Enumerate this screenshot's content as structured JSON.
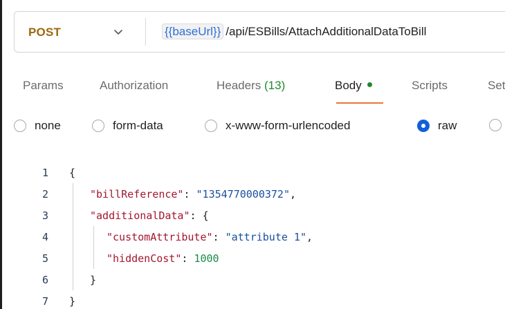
{
  "request": {
    "method": "POST",
    "url_variable": "{{baseUrl}}",
    "url_path": "/api/ESBills/AttachAdditionalDataToBill"
  },
  "tabs": [
    {
      "label": "Params"
    },
    {
      "label": "Authorization"
    },
    {
      "label": "Headers",
      "count": "(13)"
    },
    {
      "label": "Body"
    },
    {
      "label": "Scripts"
    },
    {
      "label": "Set"
    }
  ],
  "body_types": {
    "none": "none",
    "form_data": "form-data",
    "urlencoded": "x-www-form-urlencoded",
    "raw": "raw",
    "selected": "raw"
  },
  "editor": {
    "line_numbers": [
      "1",
      "2",
      "3",
      "4",
      "5",
      "6",
      "7"
    ],
    "open_brace": "{",
    "close_brace": "}",
    "key_billReference": "\"billReference\"",
    "val_billReference": "\"1354770000372\"",
    "key_additionalData": "\"additionalData\"",
    "key_customAttribute": "\"customAttribute\"",
    "val_customAttribute": "\"attribute 1\"",
    "key_hiddenCost": "\"hiddenCost\"",
    "val_hiddenCost": "1000",
    "colon": ": ",
    "comma": ","
  },
  "colors": {
    "method": "#a0660c",
    "variable": "#2f6fd6",
    "active_tab_underline": "#e8753a",
    "radio_selected": "#1160d8",
    "json_key": "#a3162f",
    "json_string": "#1a4fa0",
    "json_number": "#1a8a4a"
  }
}
